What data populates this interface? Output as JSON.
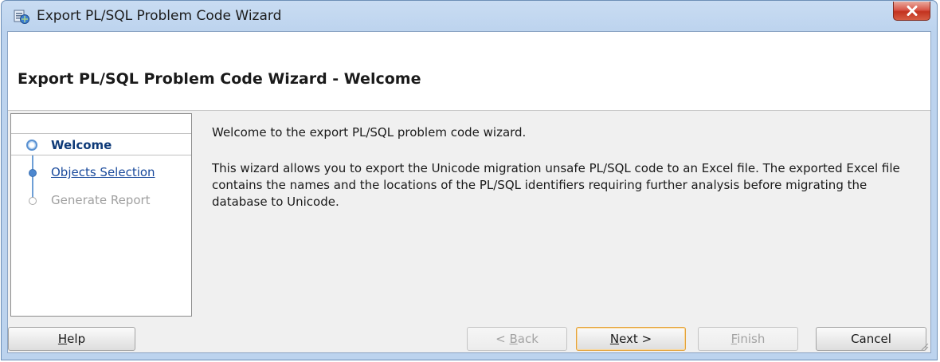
{
  "window": {
    "title": "Export PL/SQL Problem Code Wizard",
    "close_glyph": "✕"
  },
  "header": {
    "title": "Export PL/SQL Problem Code Wizard - Welcome"
  },
  "nav": {
    "items": [
      {
        "label": "Welcome",
        "state": "current"
      },
      {
        "label": "Objects Selection",
        "state": "link"
      },
      {
        "label": "Generate Report",
        "state": "disabled"
      }
    ]
  },
  "content": {
    "paragraphs": [
      "Welcome to the export PL/SQL problem code wizard.",
      "This wizard allows you to export the Unicode migration unsafe PL/SQL code to an Excel file. The exported Excel file contains the names and the locations of the PL/SQL identifiers requiring further analysis before migrating the database to Unicode."
    ]
  },
  "buttons": {
    "help": {
      "label": "Help",
      "mnemonic": "H",
      "rest": "elp"
    },
    "back": {
      "label": "< Back",
      "pre": "< ",
      "mnemonic": "B",
      "rest": "ack"
    },
    "next": {
      "label": "Next >",
      "mnemonic": "N",
      "rest": "ext >"
    },
    "finish": {
      "label": "Finish",
      "mnemonic": "F",
      "rest": "inish"
    },
    "cancel": {
      "label": "Cancel"
    }
  },
  "colors": {
    "frame": "#bcd3ee",
    "close": "#c3331f",
    "accent": "#5b92d2",
    "default_button_border": "#e3a23a"
  }
}
